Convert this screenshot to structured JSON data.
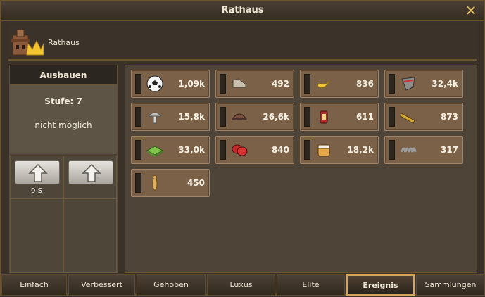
{
  "window": {
    "title": "Rathaus",
    "close_symbol": "✕"
  },
  "header": {
    "building_name": "Rathaus",
    "icon": "townhall-icon"
  },
  "upgrade": {
    "heading": "Ausbauen",
    "level": "Stufe: 7",
    "status": "nicht möglich",
    "cost": "0 S",
    "buttons": [
      "upgrade-arrow-icon",
      "premium-upgrade-arrow-icon"
    ]
  },
  "resources": [
    {
      "icon": "ball-icon",
      "value": "1,09k"
    },
    {
      "icon": "shoe-icon",
      "value": "492"
    },
    {
      "icon": "banana-icon",
      "value": "836"
    },
    {
      "icon": "shield-icon",
      "value": "32,4k"
    },
    {
      "icon": "mushroom-icon",
      "value": "15,8k"
    },
    {
      "icon": "helmet-icon",
      "value": "26,6k"
    },
    {
      "icon": "lantern-icon",
      "value": "611"
    },
    {
      "icon": "spyglass-icon",
      "value": "873"
    },
    {
      "icon": "grass-tile-icon",
      "value": "33,0k"
    },
    {
      "icon": "gloves-icon",
      "value": "840"
    },
    {
      "icon": "jar-icon",
      "value": "18,2k"
    },
    {
      "icon": "coil-icon",
      "value": "317"
    },
    {
      "icon": "figure-icon",
      "value": "450"
    }
  ],
  "tabs": [
    {
      "label": "Einfach",
      "active": false
    },
    {
      "label": "Verbessert",
      "active": false
    },
    {
      "label": "Gehoben",
      "active": false
    },
    {
      "label": "Luxus",
      "active": false
    },
    {
      "label": "Elite",
      "active": false
    },
    {
      "label": "Ereignis",
      "active": true
    },
    {
      "label": "Sammlungen",
      "active": false
    }
  ]
}
